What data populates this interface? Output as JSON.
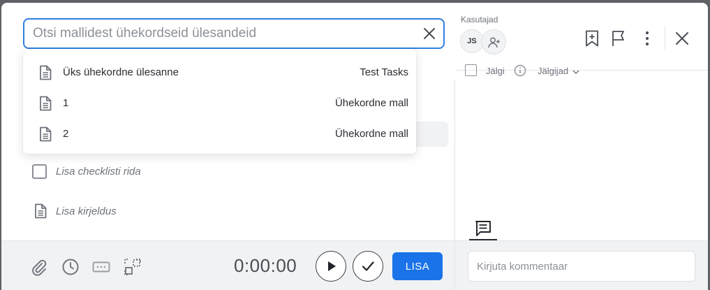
{
  "search": {
    "placeholder": "Otsi mallidest ühekordseid ülesandeid",
    "clear_icon": "close-icon"
  },
  "dropdown": {
    "items": [
      {
        "name": "Üks ühekordne ülesanne",
        "source": "Test Tasks",
        "icon": "document-icon"
      },
      {
        "name": "1",
        "source": "Ühekordne mall",
        "icon": "document-icon"
      },
      {
        "name": "2",
        "source": "Ühekordne mall",
        "icon": "document-icon"
      }
    ]
  },
  "task": {
    "checklist_placeholder": "Lisa checklisti rida",
    "description_placeholder": "Lisa kirjeldus"
  },
  "footer": {
    "timer": "0:00:00",
    "add_label": "LISA",
    "icons": [
      "paperclip-icon",
      "clock-icon",
      "ellipsis-box-icon",
      "scan-icon",
      "play-icon",
      "check-icon"
    ]
  },
  "sidebar": {
    "users_label": "Kasutajad",
    "avatar_initials": "JS",
    "follow_label": "Jälgi",
    "followers_label": "Jälgijad",
    "comment_placeholder": "Kirjuta kommentaar",
    "top_icons": [
      "bookmark-plus-icon",
      "flag-icon",
      "more-vertical-icon",
      "close-icon"
    ]
  },
  "colors": {
    "accent": "#1a73e8",
    "search_border": "#2f7fe3",
    "footer_bg": "#f1f2f4",
    "backdrop": "#5f6166"
  }
}
